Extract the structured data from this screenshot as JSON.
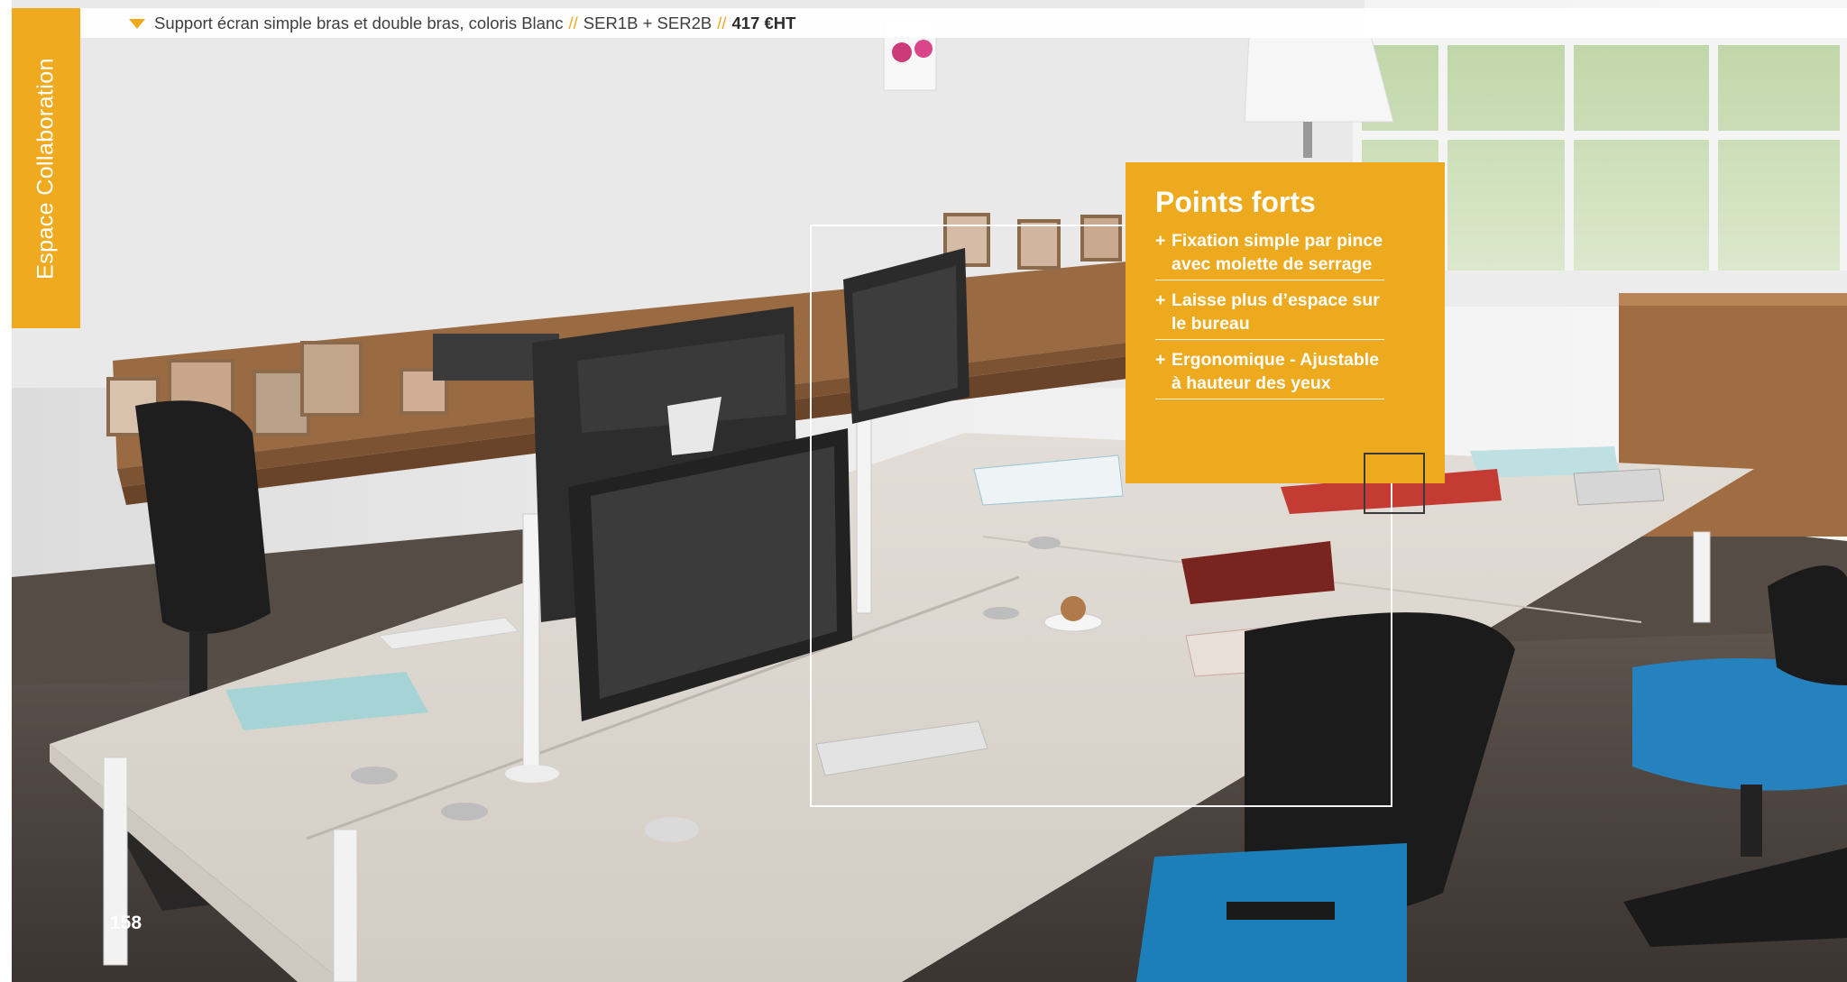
{
  "photo": {
    "description_icon": "office-photo"
  },
  "caption": {
    "text": "Support écran simple bras et double bras, coloris Blanc",
    "separator": "//",
    "references": "SER1B + SER2B",
    "price": "417 €HT"
  },
  "side_tab": {
    "label": "Espace Collaboration"
  },
  "highlights": {
    "title": "Points forts",
    "bullet": "+",
    "items": [
      {
        "label": "Fixation simple par pince avec molette de serrage"
      },
      {
        "label": "Laisse plus d’espace sur le bureau"
      },
      {
        "label": "Ergonomique - Ajustable à hauteur des yeux"
      }
    ]
  },
  "page_number": "158",
  "colors": {
    "accent": "#f0aa1f",
    "caption_text": "#3e3e3e",
    "chair_blue": "#1f7fb8"
  }
}
